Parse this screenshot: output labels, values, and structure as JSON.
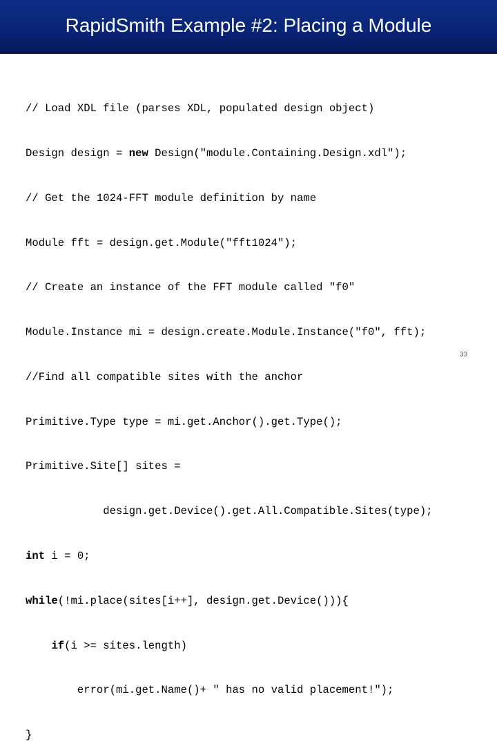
{
  "slide": {
    "title": "RapidSmith Example #2: Placing a Module",
    "page_number": "33"
  },
  "colors": {
    "title_bar": "#0a2577",
    "title_text": "#ffffff",
    "code_text": "#000000",
    "page_number_text": "#5a5a5a"
  },
  "code": {
    "lines": [
      [
        "// Load XDL file (parses XDL, populated design object)"
      ],
      [
        "Design design = ",
        "new",
        " Design(\"module.Containing.Design.xdl\");"
      ],
      [
        "// Get the 1024-FFT module definition by name"
      ],
      [
        "Module fft = design.get.Module(\"fft1024\");"
      ],
      [
        "// Create an instance of the FFT module called \"f0\""
      ],
      [
        "Module.Instance mi = design.create.Module.Instance(\"f0\", fft);"
      ],
      [
        "//Find all compatible sites with the anchor"
      ],
      [
        "Primitive.Type type = mi.get.Anchor().get.Type();"
      ],
      [
        "Primitive.Site[] sites ="
      ],
      [
        "            design.get.Device().get.All.Compatible.Sites(type);"
      ],
      [
        "",
        "int",
        " i = 0;"
      ],
      [
        "",
        "while",
        "(!mi.place(sites[i++], design.get.Device())){"
      ],
      [
        "    ",
        "if",
        "(i >= sites.length)"
      ],
      [
        "        error(mi.get.Name()+ \" has no valid placement!\");"
      ],
      [
        "}"
      ]
    ]
  }
}
